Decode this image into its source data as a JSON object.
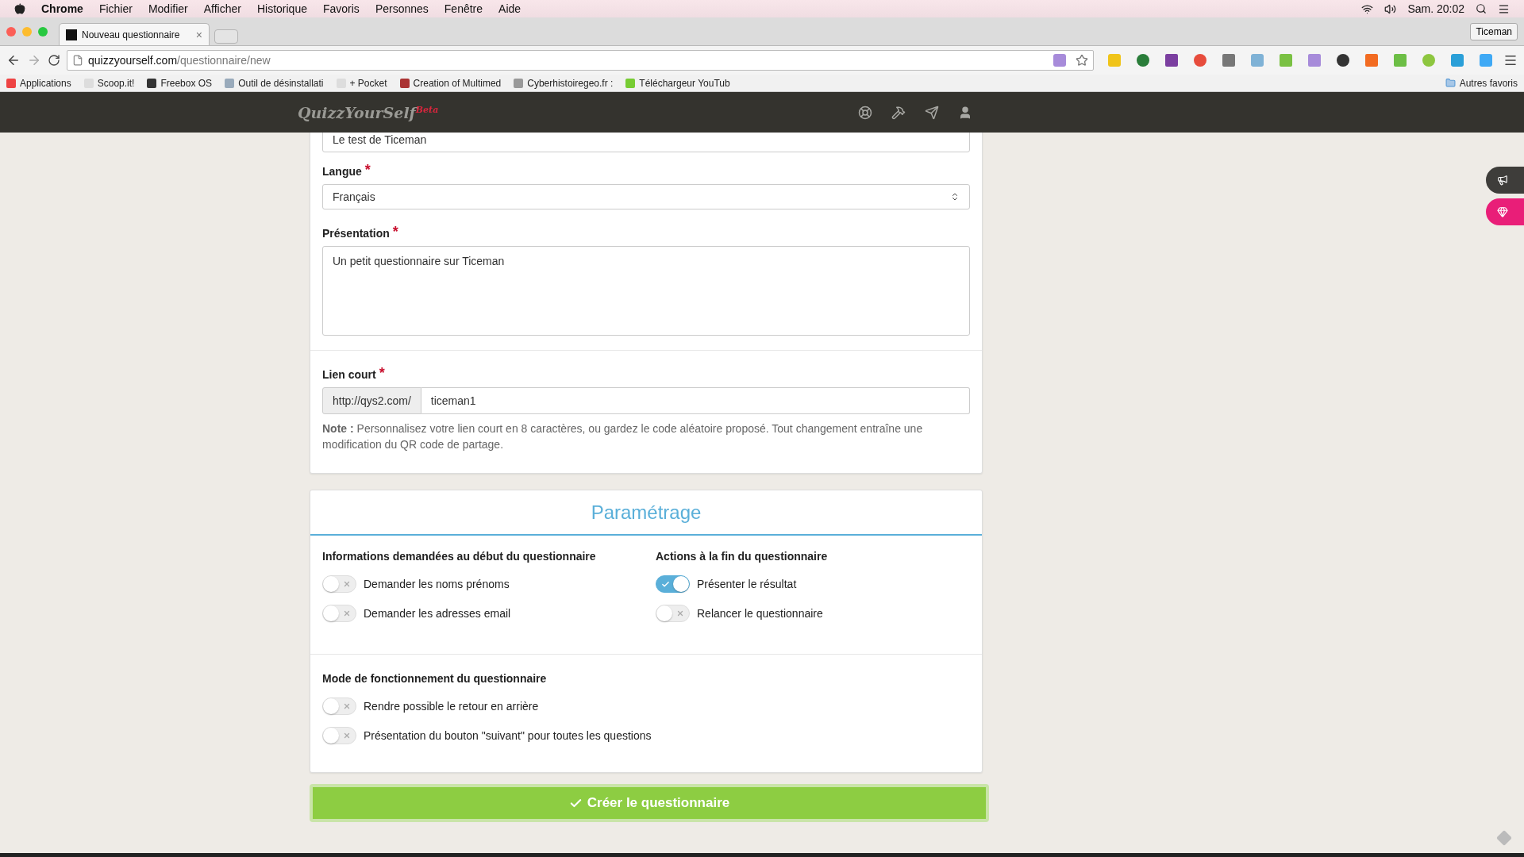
{
  "menubar": {
    "app": "Chrome",
    "menus": [
      "Fichier",
      "Modifier",
      "Afficher",
      "Historique",
      "Favoris",
      "Personnes",
      "Fenêtre",
      "Aide"
    ],
    "clock": "Sam. 20:02"
  },
  "browser": {
    "tab": {
      "title": "Nouveau questionnaire",
      "close": "×",
      "selected": true
    },
    "profile": "Ticeman",
    "url": {
      "host": "quizzyourself.com",
      "path": "/questionnaire/new"
    },
    "bookmarks": [
      "Applications",
      "Scoop.it!",
      "Freebox OS",
      "Outil de désinstallati",
      "+ Pocket",
      "Creation of Multimed",
      "Cyberhistoiregeo.fr :",
      "Téléchargeur YouTub"
    ],
    "other_bookmarks": "Autres favoris"
  },
  "site_header": {
    "logo": "QuizzYourSelf",
    "badge": "Beta"
  },
  "form": {
    "title_value": "Le test de Ticeman",
    "language": {
      "label": "Langue",
      "mark": "*",
      "value": "Français"
    },
    "presentation": {
      "label": "Présentation",
      "mark": "*",
      "value": "Un petit questionnaire sur Ticeman"
    },
    "short_link": {
      "label": "Lien court",
      "mark": "*",
      "prefix": "http://qys2.com/",
      "value": "ticeman1"
    },
    "note": "**Note :** Personnalisez votre lien court en 8 caractères, ou gardez le code aléatoire proposé. Tout changement entraîne une modification du QR code de partage."
  },
  "settings": {
    "title": "Paramétrage",
    "groups": [
      {
        "heading": "Informations demandées au début du questionnaire",
        "toggles": [
          {
            "label": "Demander les noms prénoms",
            "on": false
          },
          {
            "label": "Demander les adresses email",
            "on": false
          }
        ]
      },
      {
        "heading": "Actions à la fin du questionnaire",
        "toggles": [
          {
            "label": "Présenter le résultat",
            "on": true
          },
          {
            "label": "Relancer le questionnaire",
            "on": false
          }
        ]
      },
      {
        "heading": "Mode de fonctionnement du questionnaire",
        "toggles": [
          {
            "label": "Rendre possible le retour en arrière",
            "on": false
          },
          {
            "label": "Présentation du bouton \"suivant\" pour toutes les questions",
            "on": false
          }
        ]
      }
    ]
  },
  "submit": "Créer le questionnaire"
}
